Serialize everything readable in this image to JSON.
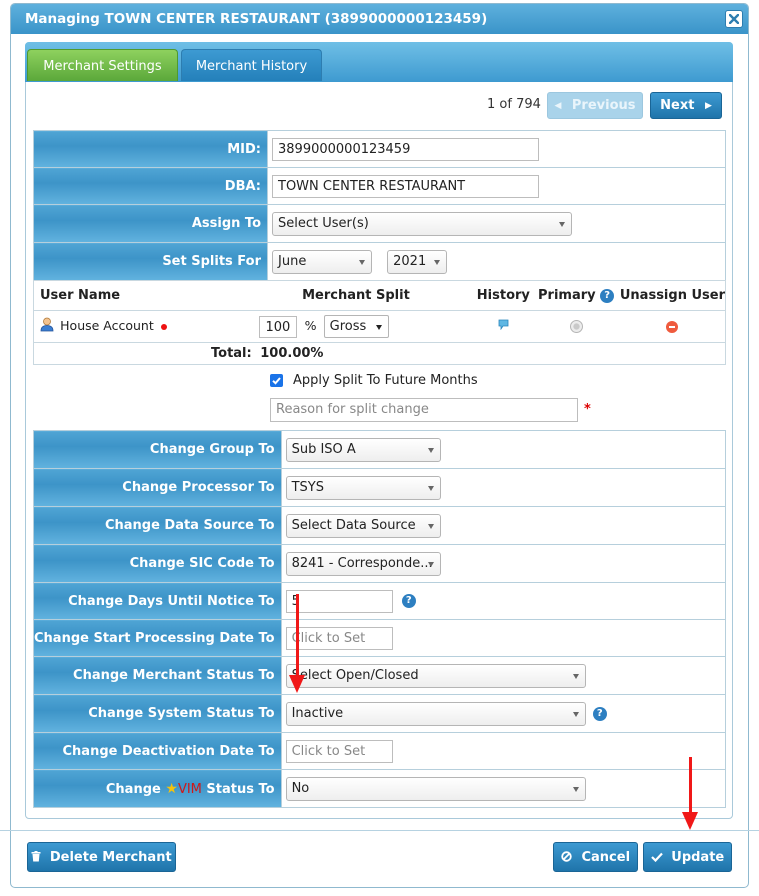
{
  "dialog": {
    "title": "Managing TOWN CENTER RESTAURANT (3899000000123459)",
    "close_icon": "close-icon"
  },
  "tabs": [
    {
      "label": "Merchant Settings",
      "active": true
    },
    {
      "label": "Merchant History",
      "active": false
    }
  ],
  "pager": {
    "text": "1 of 794",
    "previous_label": "Previous",
    "next_label": "Next"
  },
  "merchant": {
    "mid_label": "MID:",
    "mid_value": "3899000000123459",
    "dba_label": "DBA:",
    "dba_value": "TOWN CENTER RESTAURANT",
    "assign_label": "Assign To",
    "assign_value": "Select User(s)",
    "splits_label": "Set Splits For",
    "splits_month": "June",
    "splits_year": "2021"
  },
  "split_table": {
    "headers": [
      "User Name",
      "Merchant Split",
      "History",
      "Primary",
      "Unassign User"
    ],
    "row": {
      "user": "House Account",
      "split_value": "100",
      "percent": "%",
      "split_type": "Gross"
    },
    "total_label": "Total:",
    "total_value": "100.00%"
  },
  "apply_future": {
    "checked": true,
    "label": "Apply Split To Future Months"
  },
  "reason": {
    "placeholder": "Reason for split change",
    "required_mark": "*"
  },
  "changes": [
    {
      "label": "Change Group To",
      "value": "Sub ISO A",
      "kind": "select"
    },
    {
      "label": "Change Processor To",
      "value": "TSYS",
      "kind": "select"
    },
    {
      "label": "Change Data Source To",
      "value": "Select Data Source",
      "kind": "select"
    },
    {
      "label": "Change SIC Code To",
      "value": "8241 - Corresponde...",
      "kind": "select"
    },
    {
      "label": "Change Days Until Notice To",
      "value": "5",
      "kind": "input"
    },
    {
      "label": "Change Start Processing Date To",
      "value": "Click to Set",
      "kind": "date"
    },
    {
      "label": "Change Merchant Status To",
      "value": "Select Open/Closed",
      "kind": "select"
    },
    {
      "label": "Change System Status To",
      "value": "Inactive",
      "kind": "select"
    },
    {
      "label": "Change Deactivation Date To",
      "value": "Click to Set",
      "kind": "date"
    },
    {
      "label_prefix": "Change",
      "label_vim": "VIM",
      "label_suffix": "Status To",
      "value": "No",
      "kind": "select"
    }
  ],
  "footer": {
    "delete_label": "Delete Merchant",
    "cancel_label": "Cancel",
    "update_label": "Update"
  },
  "colors": {
    "header_blue": "#3d94c8",
    "tab_active_green": "#5ba83a",
    "annotation_red": "#f01818"
  }
}
